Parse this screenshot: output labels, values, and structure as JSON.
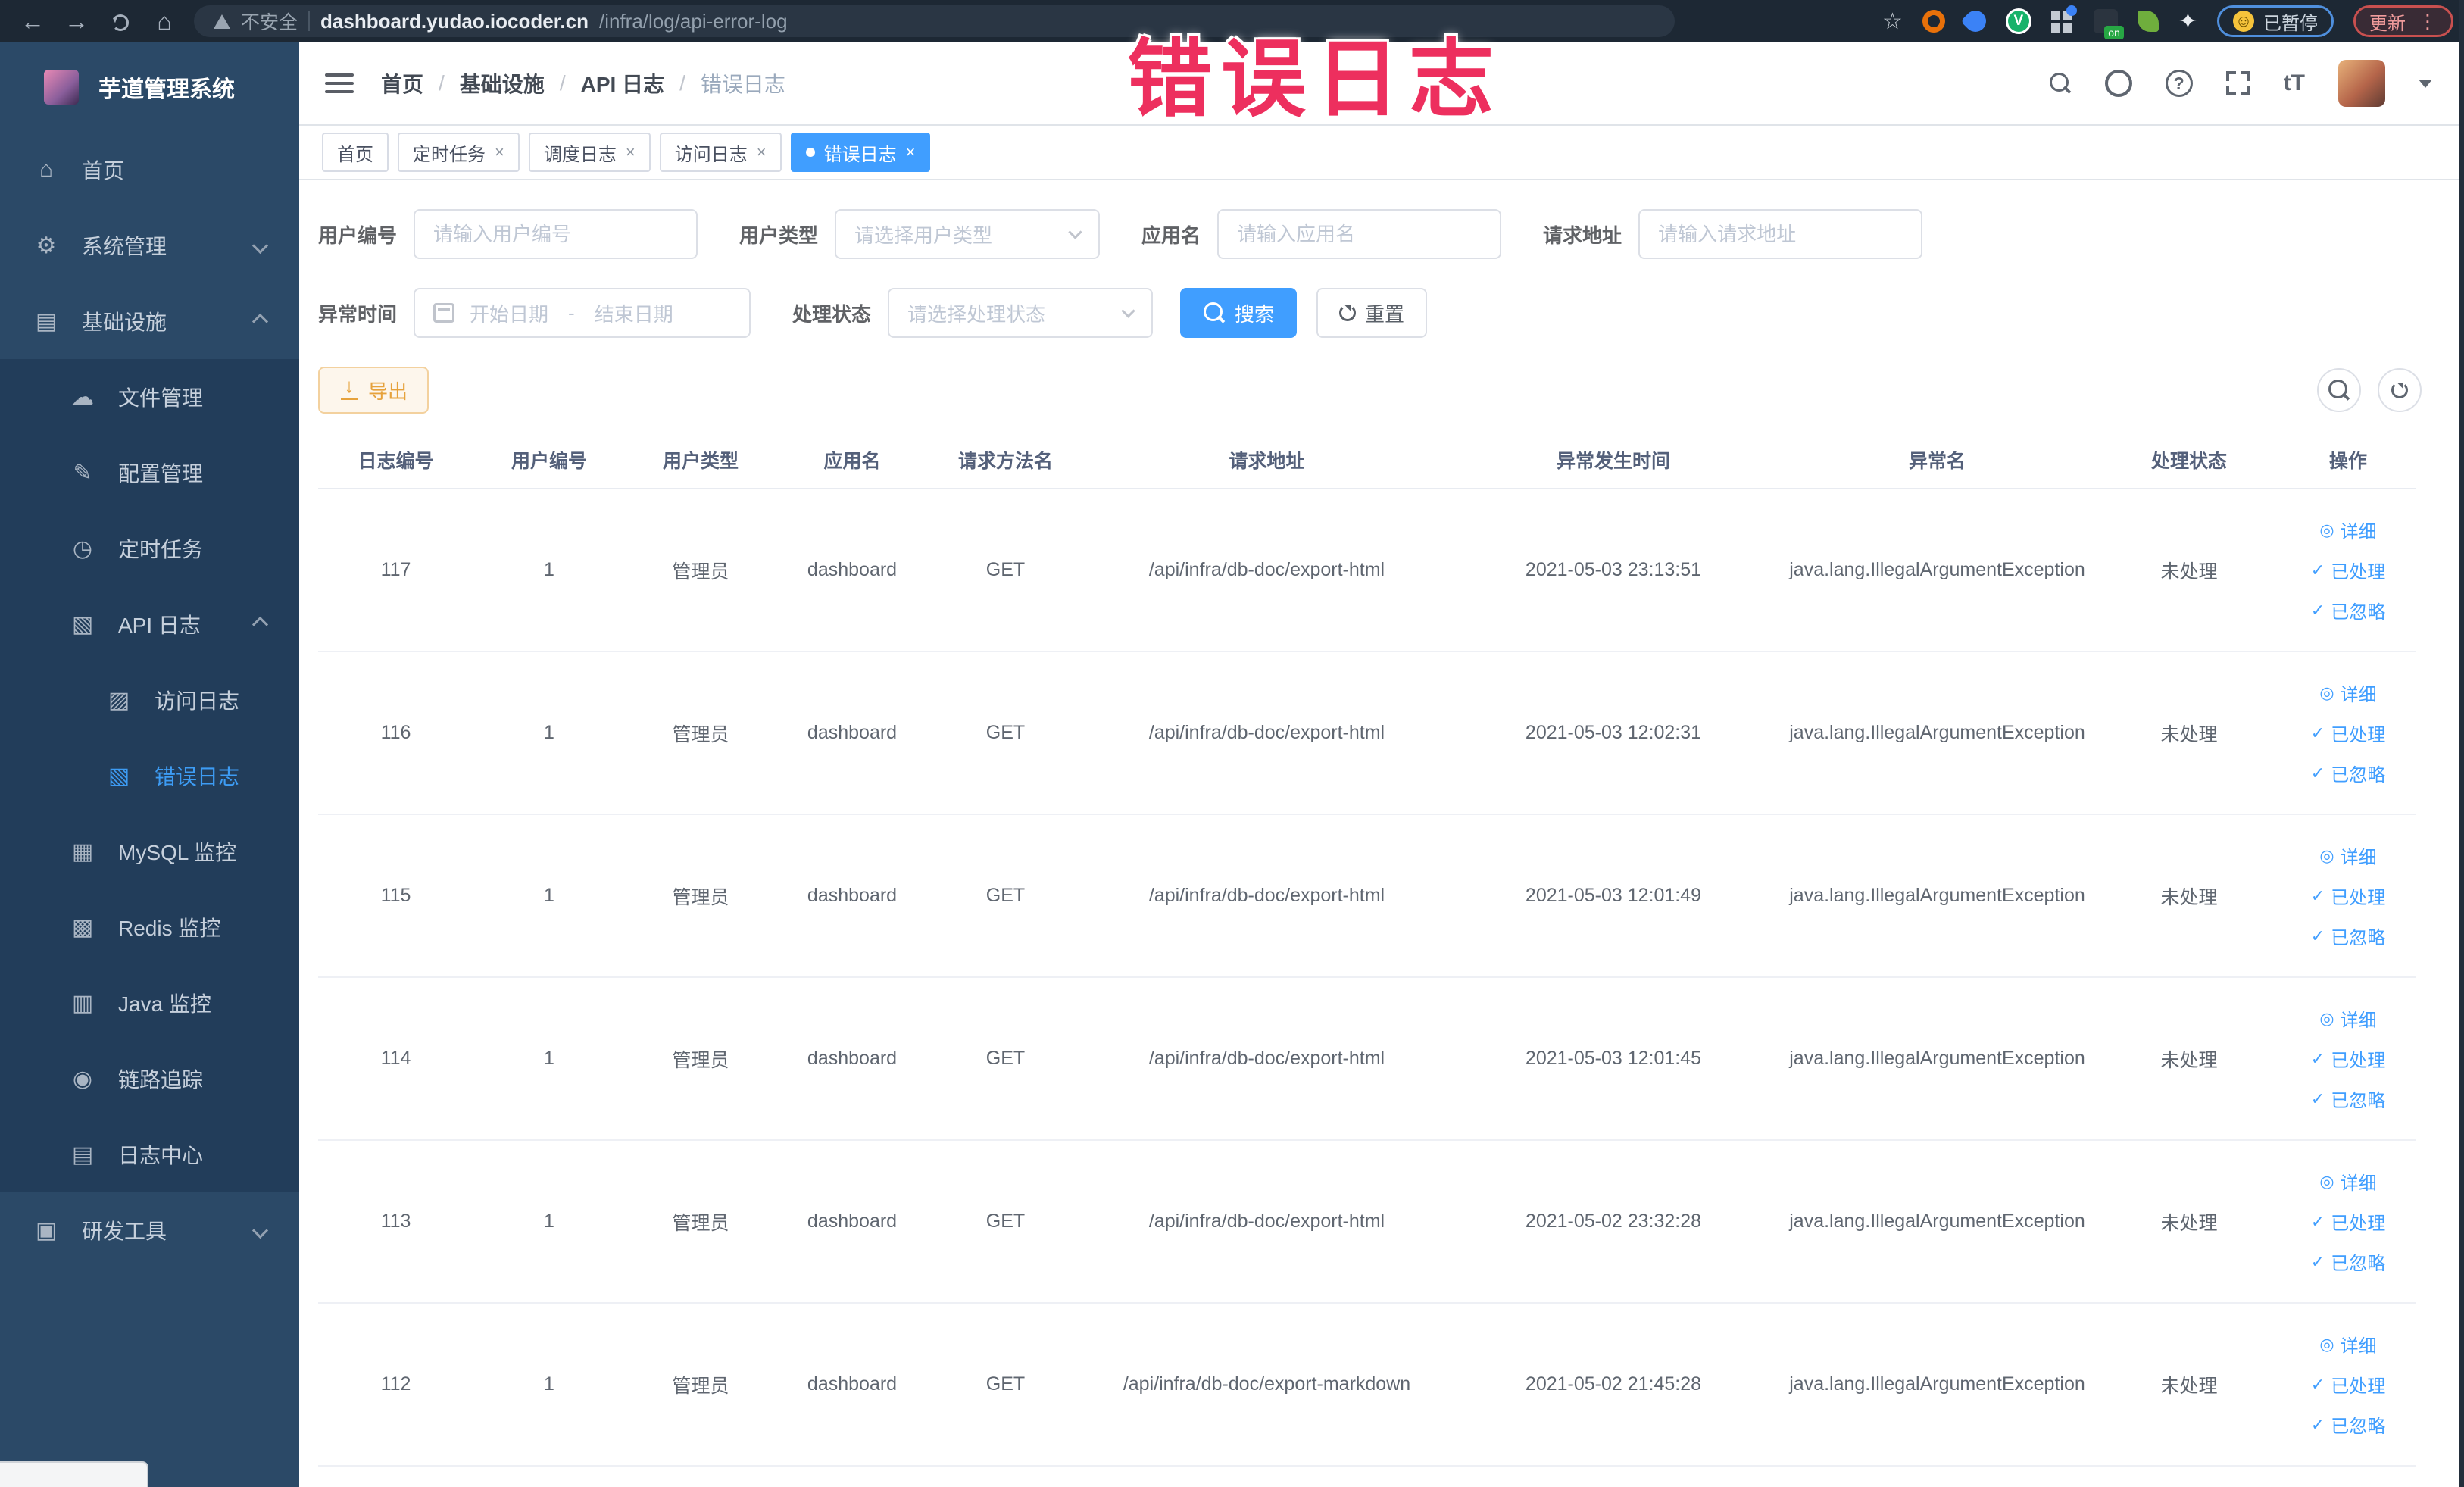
{
  "browser": {
    "security_label": "不安全",
    "url_host": "dashboard.yudao.iocoder.cn",
    "url_path": "/infra/log/api-error-log",
    "paused_label": "已暂停",
    "update_label": "更新",
    "extensions": [
      {
        "kind": "star",
        "name": "bookmark-star-icon"
      },
      {
        "kind": "orange-ring",
        "name": "extension-orange-icon",
        "color": "#e8710a"
      },
      {
        "kind": "blue-drop",
        "name": "extension-blue-icon",
        "color": "#3b82f6"
      },
      {
        "kind": "green-v",
        "name": "extension-green-v-icon",
        "color": "#17b26a"
      },
      {
        "kind": "grid",
        "name": "extension-grid-icon"
      },
      {
        "kind": "dark-on",
        "name": "extension-switch-on-icon",
        "color": "#27a744"
      },
      {
        "kind": "leaf",
        "name": "extension-leaf-icon",
        "color": "#6fae3d"
      },
      {
        "kind": "puzzle",
        "name": "extensions-puzzle-icon"
      }
    ]
  },
  "annotation": {
    "text": "错误日志",
    "color": "#ed2f5e"
  },
  "sidebar": {
    "title": "芋道管理系统",
    "menu": [
      {
        "key": "home",
        "label": "首页",
        "icon": "home-icon",
        "level": 0
      },
      {
        "key": "system",
        "label": "系统管理",
        "icon": "gear-icon",
        "level": 0,
        "chevron": "down"
      },
      {
        "key": "infra",
        "label": "基础设施",
        "icon": "monitor-icon",
        "level": 0,
        "chevron": "up"
      },
      {
        "key": "file",
        "label": "文件管理",
        "icon": "cloud-upload-icon",
        "level": 1,
        "sub": true
      },
      {
        "key": "config",
        "label": "配置管理",
        "icon": "edit-icon",
        "level": 1,
        "sub": true
      },
      {
        "key": "job",
        "label": "定时任务",
        "icon": "clock-icon",
        "level": 1,
        "sub": true
      },
      {
        "key": "apilog",
        "label": "API 日志",
        "icon": "log-icon",
        "level": 1,
        "sub": true,
        "chevron": "up"
      },
      {
        "key": "accesslog",
        "label": "访问日志",
        "icon": "access-log-icon",
        "level": 2,
        "sub": true
      },
      {
        "key": "errorlog",
        "label": "错误日志",
        "icon": "error-log-icon",
        "level": 2,
        "sub": true,
        "active": true
      },
      {
        "key": "mysql",
        "label": "MySQL 监控",
        "icon": "mysql-icon",
        "level": 1,
        "sub": true
      },
      {
        "key": "redis",
        "label": "Redis 监控",
        "icon": "redis-icon",
        "level": 1,
        "sub": true
      },
      {
        "key": "java",
        "label": "Java 监控",
        "icon": "java-icon",
        "level": 1,
        "sub": true
      },
      {
        "key": "trace",
        "label": "链路追踪",
        "icon": "trace-eye-icon",
        "level": 1,
        "sub": true
      },
      {
        "key": "logcenter",
        "label": "日志中心",
        "icon": "log-center-icon",
        "level": 1,
        "sub": true
      },
      {
        "key": "tools",
        "label": "研发工具",
        "icon": "toolbox-icon",
        "level": 0,
        "chevron": "down"
      }
    ]
  },
  "navbar": {
    "breadcrumb": [
      "首页",
      "基础设施",
      "API 日志",
      "错误日志"
    ]
  },
  "tags": [
    {
      "key": "home",
      "label": "首页",
      "closable": false,
      "active": false
    },
    {
      "key": "job",
      "label": "定时任务",
      "closable": true,
      "active": false
    },
    {
      "key": "job-log",
      "label": "调度日志",
      "closable": true,
      "active": false
    },
    {
      "key": "access-log",
      "label": "访问日志",
      "closable": true,
      "active": false
    },
    {
      "key": "error-log",
      "label": "错误日志",
      "closable": true,
      "active": true
    }
  ],
  "filters": {
    "user_id": {
      "label": "用户编号",
      "placeholder": "请输入用户编号"
    },
    "user_type": {
      "label": "用户类型",
      "placeholder": "请选择用户类型"
    },
    "app_name": {
      "label": "应用名",
      "placeholder": "请输入应用名"
    },
    "request_url": {
      "label": "请求地址",
      "placeholder": "请输入请求地址"
    },
    "exception_time": {
      "label": "异常时间",
      "start_placeholder": "开始日期",
      "separator": "-",
      "end_placeholder": "结束日期"
    },
    "process_status": {
      "label": "处理状态",
      "placeholder": "请选择处理状态"
    },
    "search_label": "搜索",
    "reset_label": "重置"
  },
  "toolbar": {
    "export_label": "导出"
  },
  "table": {
    "columns": [
      "日志编号",
      "用户编号",
      "用户类型",
      "应用名",
      "请求方法名",
      "请求地址",
      "异常发生时间",
      "异常名",
      "处理状态",
      "操作"
    ],
    "actions": [
      {
        "key": "detail",
        "label": "详细",
        "icon": "eye-icon"
      },
      {
        "key": "processed",
        "label": "已处理",
        "icon": "check-icon"
      },
      {
        "key": "ignored",
        "label": "已忽略",
        "icon": "check-icon"
      }
    ],
    "rows": [
      {
        "id": "117",
        "user_id": "1",
        "user_type": "管理员",
        "app": "dashboard",
        "method": "GET",
        "url": "/api/infra/db-doc/export-html",
        "time": "2021-05-03 23:13:51",
        "exception": "java.lang.IllegalArgumentException",
        "status": "未处理"
      },
      {
        "id": "116",
        "user_id": "1",
        "user_type": "管理员",
        "app": "dashboard",
        "method": "GET",
        "url": "/api/infra/db-doc/export-html",
        "time": "2021-05-03 12:02:31",
        "exception": "java.lang.IllegalArgumentException",
        "status": "未处理"
      },
      {
        "id": "115",
        "user_id": "1",
        "user_type": "管理员",
        "app": "dashboard",
        "method": "GET",
        "url": "/api/infra/db-doc/export-html",
        "time": "2021-05-03 12:01:49",
        "exception": "java.lang.IllegalArgumentException",
        "status": "未处理"
      },
      {
        "id": "114",
        "user_id": "1",
        "user_type": "管理员",
        "app": "dashboard",
        "method": "GET",
        "url": "/api/infra/db-doc/export-html",
        "time": "2021-05-03 12:01:45",
        "exception": "java.lang.IllegalArgumentException",
        "status": "未处理"
      },
      {
        "id": "113",
        "user_id": "1",
        "user_type": "管理员",
        "app": "dashboard",
        "method": "GET",
        "url": "/api/infra/db-doc/export-html",
        "time": "2021-05-02 23:32:28",
        "exception": "java.lang.IllegalArgumentException",
        "status": "未处理"
      },
      {
        "id": "112",
        "user_id": "1",
        "user_type": "管理员",
        "app": "dashboard",
        "method": "GET",
        "url": "/api/infra/db-doc/export-markdown",
        "time": "2021-05-02 21:45:28",
        "exception": "java.lang.IllegalArgumentException",
        "status": "未处理"
      }
    ]
  },
  "colors": {
    "primary": "#409eff",
    "warning": "#e6a23c",
    "sidebar_bg": "#2b4967",
    "sidebar_sub_bg": "#223d5a"
  }
}
